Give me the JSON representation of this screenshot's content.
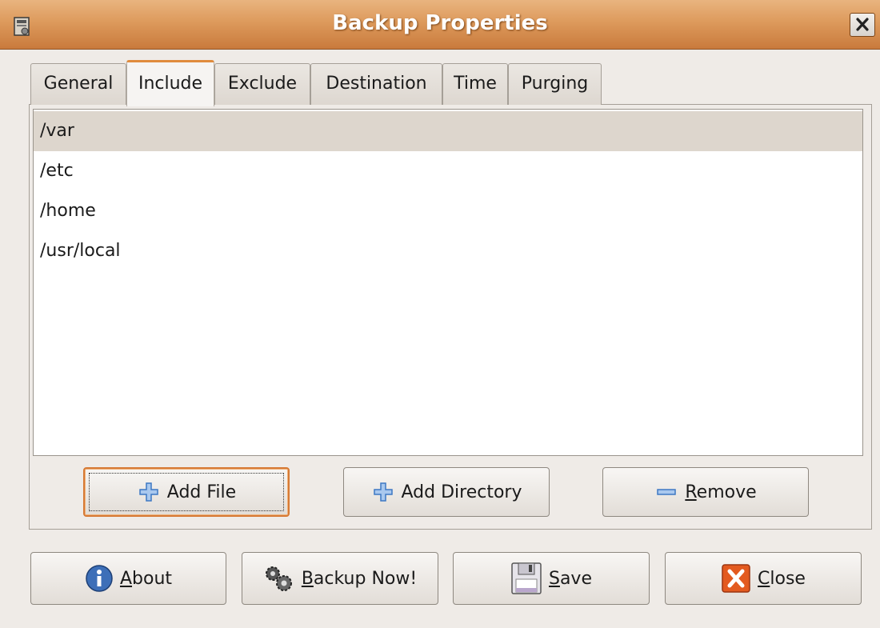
{
  "window": {
    "title": "Backup Properties",
    "icon": "backup-app-icon",
    "close_icon": "close-icon"
  },
  "tabs": [
    {
      "label": "General",
      "active": false
    },
    {
      "label": "Include",
      "active": true
    },
    {
      "label": "Exclude",
      "active": false
    },
    {
      "label": "Destination",
      "active": false
    },
    {
      "label": "Time",
      "active": false
    },
    {
      "label": "Purging",
      "active": false
    }
  ],
  "include_list": {
    "items": [
      "/var",
      "/etc",
      "/home",
      "/usr/local"
    ],
    "selected_index": 0
  },
  "list_actions": {
    "add_file": {
      "label": "Add File",
      "icon": "plus-icon"
    },
    "add_directory": {
      "label": "Add Directory",
      "icon": "plus-icon"
    },
    "remove": {
      "label_mnemonic": "R",
      "label_rest": "emove",
      "icon": "minus-icon"
    }
  },
  "footer": {
    "about": {
      "label_mnemonic": "A",
      "label_rest": "bout",
      "icon": "info-icon"
    },
    "backup_now": {
      "label_mnemonic": "B",
      "label_rest": "ackup Now!",
      "icon": "gears-icon"
    },
    "save": {
      "label_mnemonic": "S",
      "label_rest": "ave",
      "icon": "floppy-disk-icon"
    },
    "close": {
      "label_mnemonic": "C",
      "label_rest": "lose",
      "icon": "close-x-icon"
    }
  },
  "colors": {
    "titlebar": "#dd9a5c",
    "accent": "#e08b3d",
    "selection": "#ddd6cd",
    "background": "#efebe7",
    "icon_blue": "#3d78c4",
    "close_red": "#e35a1f"
  }
}
